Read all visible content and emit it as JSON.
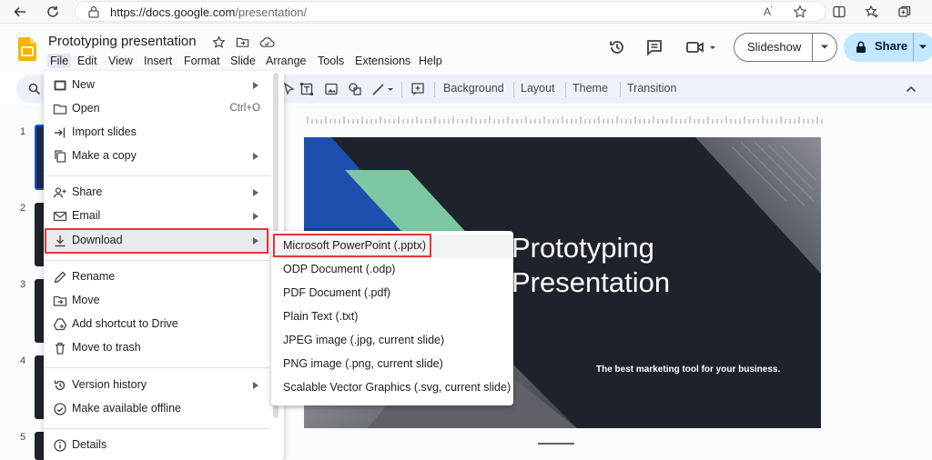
{
  "browser": {
    "url_host": "https://docs.google.com",
    "url_path": "/presentation/"
  },
  "app": {
    "title": "Prototyping presentation",
    "brand_color": "#f4b400",
    "menu": [
      "File",
      "Edit",
      "View",
      "Insert",
      "Format",
      "Slide",
      "Arrange",
      "Tools",
      "Extensions",
      "Help"
    ],
    "slideshow_label": "Slideshow",
    "share_label": "Share"
  },
  "toolbar": {
    "background_label": "Background",
    "layout_label": "Layout",
    "theme_label": "Theme",
    "transition_label": "Transition"
  },
  "filmstrip": {
    "slide_numbers": [
      "1",
      "2",
      "3",
      "4",
      "5"
    ]
  },
  "file_menu": {
    "items": [
      {
        "label": "New",
        "icon": "new-slide-icon",
        "submenu": true
      },
      {
        "label": "Open",
        "icon": "folder-icon",
        "shortcut": "Ctrl+O"
      },
      {
        "label": "Import slides",
        "icon": "import-icon"
      },
      {
        "label": "Make a copy",
        "icon": "copy-icon",
        "submenu": true
      },
      {
        "label": "Share",
        "icon": "person-add-icon",
        "submenu": true
      },
      {
        "label": "Email",
        "icon": "email-icon",
        "submenu": true
      },
      {
        "label": "Download",
        "icon": "download-icon",
        "submenu": true,
        "highlighted": true
      },
      {
        "label": "Rename",
        "icon": "pencil-icon"
      },
      {
        "label": "Move",
        "icon": "move-folder-icon"
      },
      {
        "label": "Add shortcut to Drive",
        "icon": "drive-shortcut-icon"
      },
      {
        "label": "Move to trash",
        "icon": "trash-icon"
      },
      {
        "label": "Version history",
        "icon": "history-icon",
        "submenu": true
      },
      {
        "label": "Make available offline",
        "icon": "offline-icon"
      },
      {
        "label": "Details",
        "icon": "info-icon"
      }
    ]
  },
  "download_submenu": {
    "items": [
      "Microsoft PowerPoint (.pptx)",
      "ODP Document (.odp)",
      "PDF Document (.pdf)",
      "Plain Text (.txt)",
      "JPEG image (.jpg, current slide)",
      "PNG image (.png, current slide)",
      "Scalable Vector Graphics (.svg, current slide)"
    ]
  },
  "slide": {
    "title": "Prototyping\nPresentation",
    "subtitle": "The best marketing tool for your business.",
    "background_color": "#1e232b",
    "accent_blue": "#1e4fae",
    "accent_green": "#7cc8a3"
  },
  "colors": {
    "highlight_outline": "#e03a3a",
    "share_button": "#c2e7ff"
  }
}
